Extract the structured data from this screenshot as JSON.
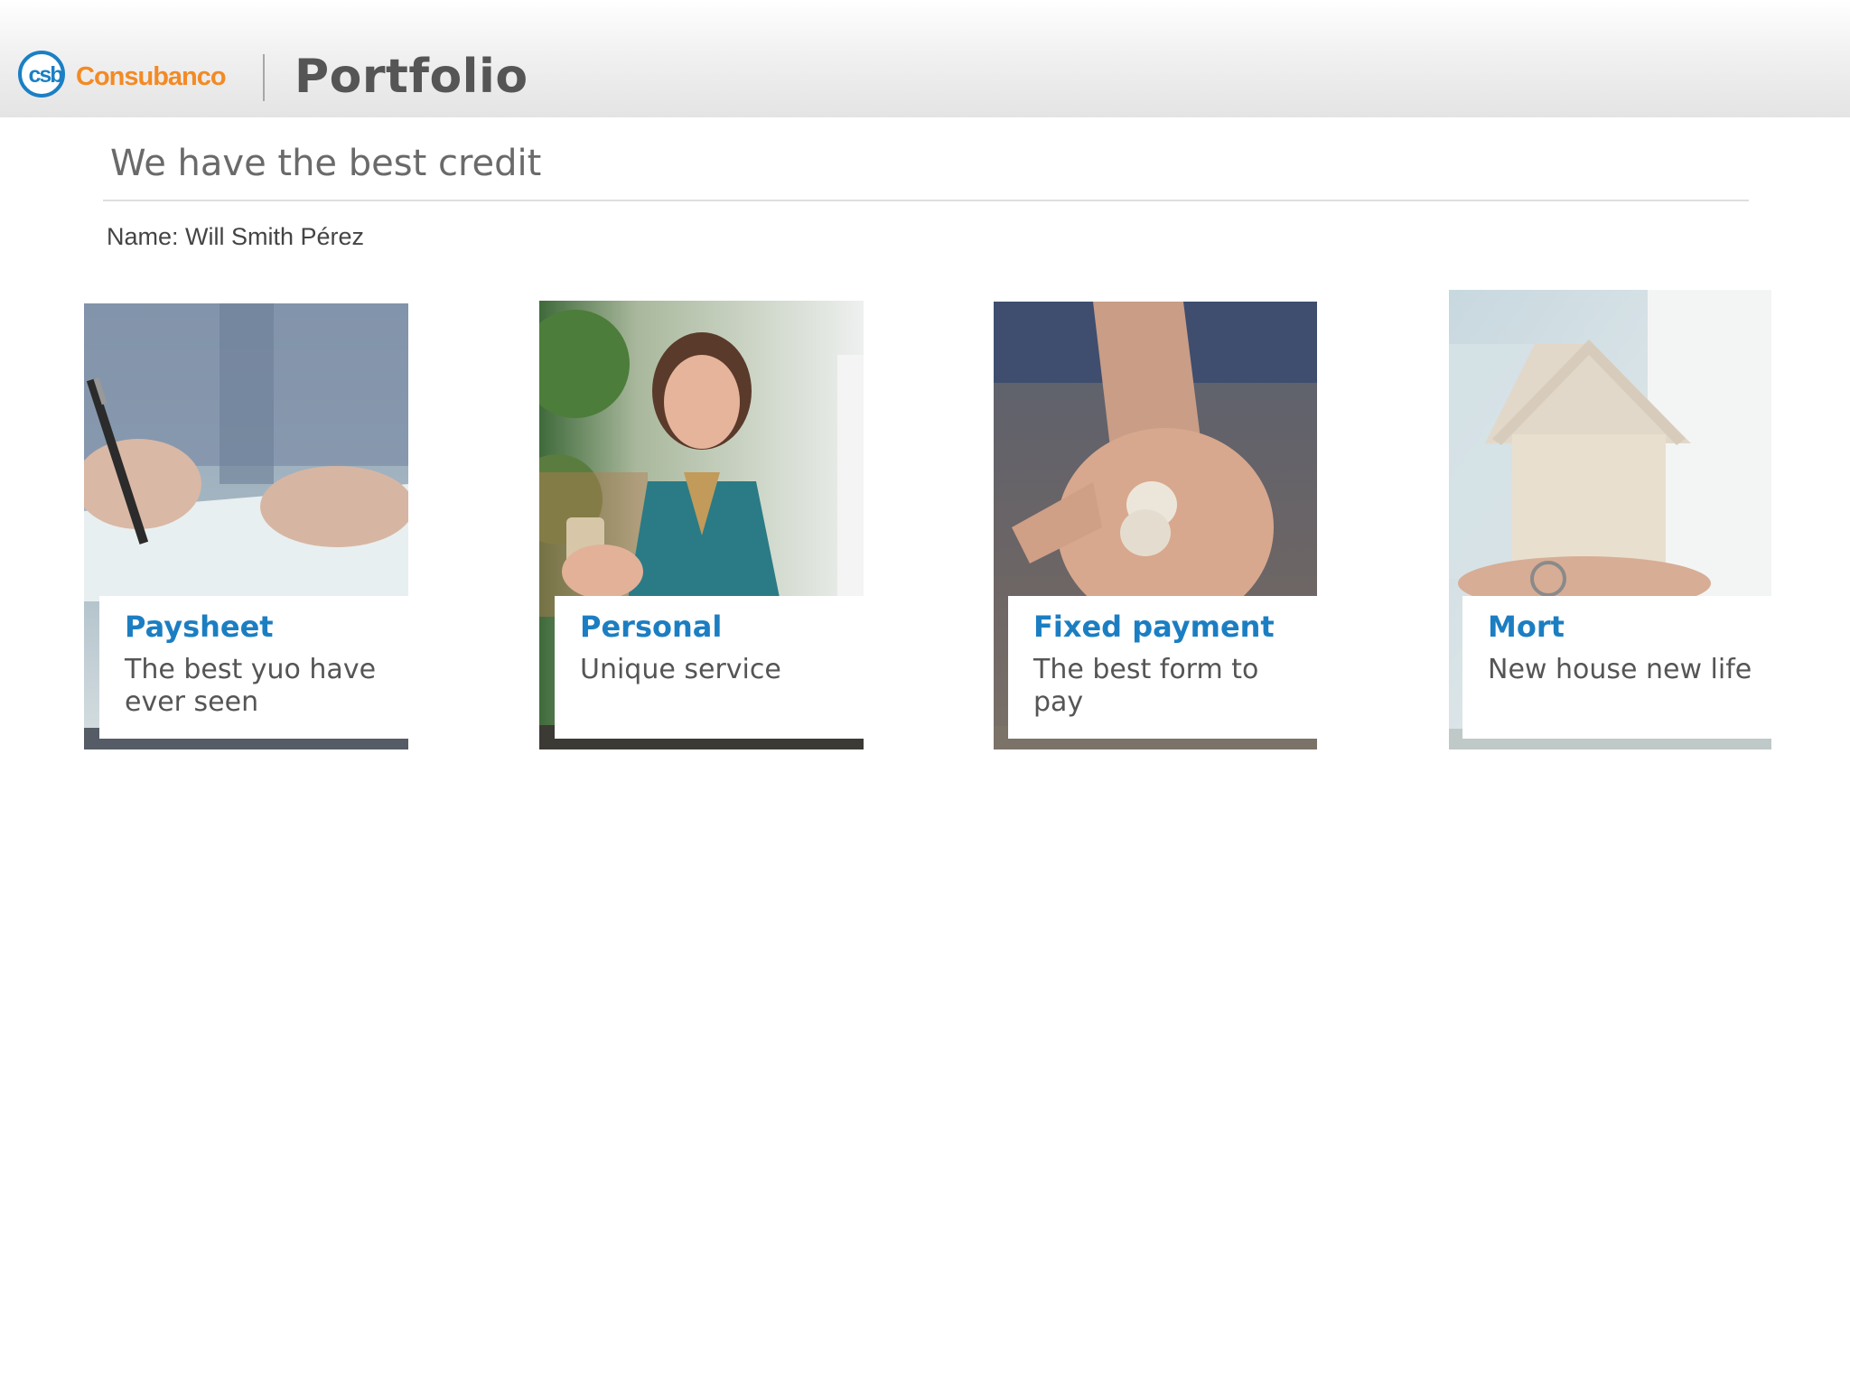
{
  "brand": {
    "logo_mark": "csb",
    "logo_word": "Consubanco"
  },
  "header": {
    "title": "Portfolio"
  },
  "subtitle": "We have the best credit",
  "user": {
    "name_line": "Name: Will Smith Pérez"
  },
  "products": [
    {
      "title": "Paysheet",
      "description": "The best yuo have ever seen",
      "photo_icon": "pen-signing-photo"
    },
    {
      "title": "Personal",
      "description": "Unique service",
      "photo_icon": "woman-phone-photo"
    },
    {
      "title": "Fixed payment",
      "description": "The best form to pay",
      "photo_icon": "coins-hand-photo"
    },
    {
      "title": "Mort",
      "description": "New house new life",
      "photo_icon": "house-keys-photo"
    }
  ],
  "colors": {
    "accent": "#1c7ec2",
    "brand_orange": "#f38a24",
    "text": "#555555"
  }
}
